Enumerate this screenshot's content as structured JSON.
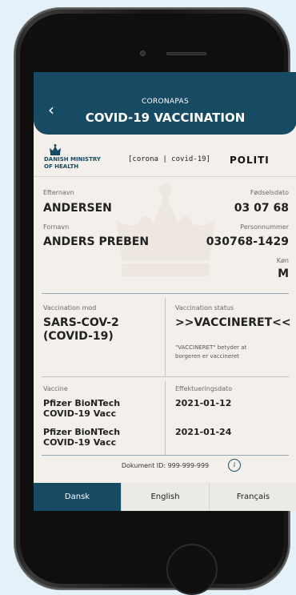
{
  "header": {
    "subtitle": "CORONAPAS",
    "title": "COVID-19 VACCINATION",
    "back_icon": "‹"
  },
  "logos": {
    "ministry_line1": "DANISH MINISTRY",
    "ministry_line2": "OF HEALTH",
    "corona": "[corona | covid-19]",
    "politi": "POLITI"
  },
  "person": {
    "surname_label": "Efternavn",
    "surname": "ANDERSEN",
    "dob_label": "Fødselsdato",
    "dob": "03 07 68",
    "firstname_label": "Fornavn",
    "firstname": "ANDERS PREBEN",
    "cpr_label": "Personnummer",
    "cpr": "030768-1429",
    "sex_label": "Køn",
    "sex": "M"
  },
  "vaccination": {
    "against_label": "Vaccination mod",
    "against_line1": "SARS-COV-2",
    "against_line2": "(COVID-19)",
    "status_label": "Vaccination status",
    "status": ">>VACCINERET<<",
    "status_note_line1": "\"VACCINERET\" betyder at",
    "status_note_line2": "borgeren er vaccineret"
  },
  "doses": {
    "vaccine_label": "Vaccine",
    "date_label": "Effektueringsdato",
    "items": [
      {
        "line1": "Pfizer BioNTech",
        "line2": "COVID-19 Vacc",
        "date": "2021-01-12"
      },
      {
        "line1": "Pfizer BioNTech",
        "line2": "COVID-19 Vacc",
        "date": "2021-01-24"
      }
    ]
  },
  "document": {
    "id_text": "Dokument ID: 999-999-999",
    "info_icon": "i"
  },
  "languages": {
    "tabs": [
      "Dansk",
      "English",
      "Français"
    ],
    "active": "Dansk"
  },
  "colors": {
    "primary": "#174a63",
    "background": "#f3efea",
    "page": "#e4f1f9"
  }
}
